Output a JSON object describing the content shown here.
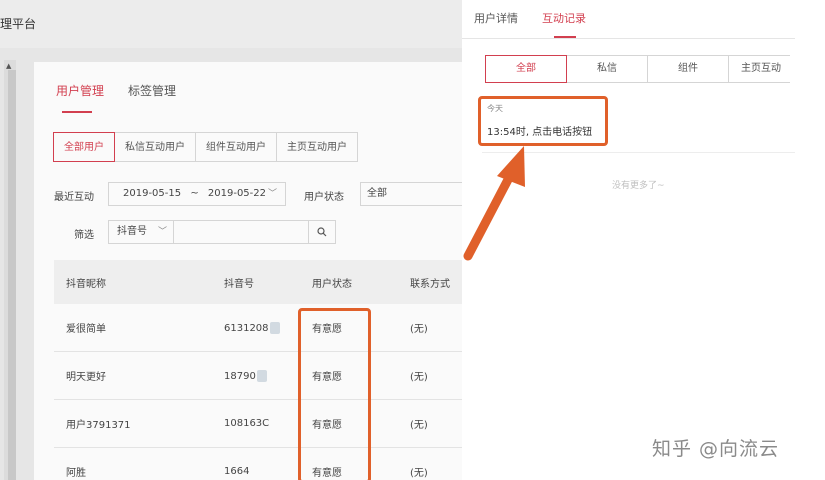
{
  "app": {
    "title": "理平台"
  },
  "main": {
    "tabs": [
      {
        "label": "用户管理",
        "active": true
      },
      {
        "label": "标签管理",
        "active": false
      }
    ],
    "segments": [
      {
        "label": "全部用户",
        "active": true
      },
      {
        "label": "私信互动用户",
        "active": false
      },
      {
        "label": "组件互动用户",
        "active": false
      },
      {
        "label": "主页互动用户",
        "active": false
      }
    ],
    "filters": {
      "recent_label": "最近互动",
      "date_start": "2019-05-15",
      "date_sep": "~",
      "date_end": "2019-05-22",
      "status_label": "用户状态",
      "status_value": "全部",
      "filter_label": "筛选",
      "account_type": "抖音号",
      "search_icon": "search-icon"
    },
    "table": {
      "headers": [
        "抖音昵称",
        "抖音号",
        "用户状态",
        "联系方式"
      ],
      "rows": [
        {
          "nickname": "爱很简单",
          "id": "6131208",
          "status": "有意愿",
          "contact": "(无)"
        },
        {
          "nickname": "明天更好",
          "id": "18790",
          "status": "有意愿",
          "contact": "(无)"
        },
        {
          "nickname": "用户3791371",
          "id": "108163C",
          "status": "有意愿",
          "contact": "(无)"
        },
        {
          "nickname": "阿胜",
          "id": "1664",
          "status": "有意愿",
          "contact": "(无)"
        }
      ]
    }
  },
  "panel": {
    "tabs": [
      {
        "label": "用户详情",
        "active": false
      },
      {
        "label": "互动记录",
        "active": true
      }
    ],
    "segments": [
      {
        "label": "全部",
        "active": true
      },
      {
        "label": "私信",
        "active": false
      },
      {
        "label": "组件",
        "active": false
      },
      {
        "label": "主页互动",
        "active": false
      }
    ],
    "record": {
      "day": "今天",
      "text": "13:54时, 点击电话按钮"
    },
    "empty_text": "没有更多了~"
  },
  "watermark": "知乎 @向流云",
  "colors": {
    "accent": "#d23f4f",
    "highlight": "#e0602a"
  }
}
